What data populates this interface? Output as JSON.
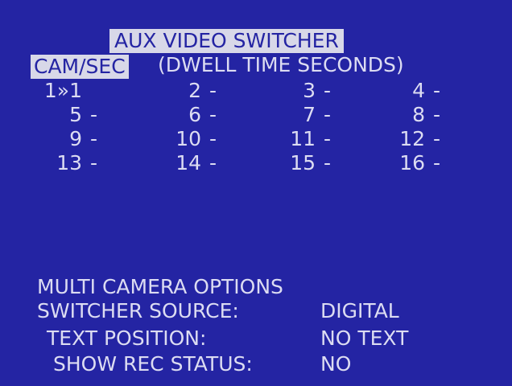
{
  "screen": {
    "background": "#2424a3",
    "text_color": "#dcdcf2",
    "highlight_color": "#d8d8e8"
  },
  "header": {
    "title": "AUX VIDEO SWITCHER",
    "cam_sec_label": "CAM/SEC",
    "dwell_caption": "(DWELL TIME SECONDS)"
  },
  "grid": {
    "rows": [
      [
        {
          "cam": "1»1",
          "dwell": ""
        },
        {
          "cam": "2",
          "dwell": "-"
        },
        {
          "cam": "3",
          "dwell": "-"
        },
        {
          "cam": "4",
          "dwell": "-"
        }
      ],
      [
        {
          "cam": "5",
          "dwell": "-"
        },
        {
          "cam": "6",
          "dwell": "-"
        },
        {
          "cam": "7",
          "dwell": "-"
        },
        {
          "cam": "8",
          "dwell": "-"
        }
      ],
      [
        {
          "cam": "9",
          "dwell": "-"
        },
        {
          "cam": "10",
          "dwell": "-"
        },
        {
          "cam": "11",
          "dwell": "-"
        },
        {
          "cam": "12",
          "dwell": "-"
        }
      ],
      [
        {
          "cam": "13",
          "dwell": "-"
        },
        {
          "cam": "14",
          "dwell": "-"
        },
        {
          "cam": "15",
          "dwell": "-"
        },
        {
          "cam": "16",
          "dwell": "-"
        }
      ]
    ]
  },
  "multi_camera_options": {
    "title": "MULTI CAMERA OPTIONS",
    "options": [
      {
        "label": "SWITCHER SOURCE:",
        "value": "DIGITAL"
      },
      {
        "label": "TEXT POSITION:",
        "value": "NO TEXT"
      },
      {
        "label": "SHOW REC STATUS:",
        "value": "NO"
      }
    ]
  }
}
